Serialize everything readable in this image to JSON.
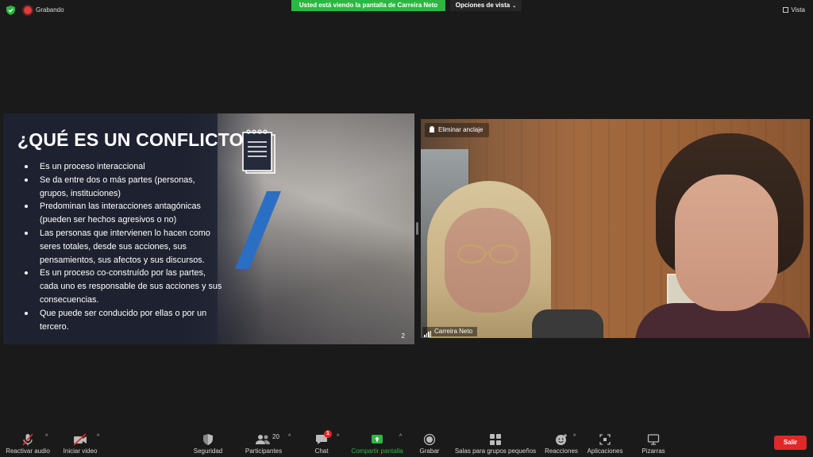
{
  "topbar": {
    "recording_label": "Grabando",
    "share_banner": "Usted está viendo la pantalla de Carreira Neto",
    "view_options_label": "Opciones de vista",
    "view_label": "Vista"
  },
  "slide": {
    "title": "¿QUÉ ES UN CONFLICTO?",
    "bullets": [
      "Es un proceso interaccional",
      "Se da entre dos o más partes (personas, grupos, instituciones)",
      "Predominan las interacciones antagónicas (pueden ser hechos agresivos o no)",
      "Las personas que intervienen lo hacen como seres totales, desde sus acciones, sus pensamientos, sus afectos y sus discursos.",
      "Es un proceso co-construído por las partes, cada uno es responsable de sus acciones y sus consecuencias.",
      "Que puede ser conducido por ellas o por un tercero."
    ],
    "page_number": "2"
  },
  "video": {
    "unpin_label": "Eliminar anclaje",
    "participant_name": "Carreira Neto"
  },
  "toolbar": {
    "unmute_label": "Reactivar audio",
    "start_video_label": "Iniciar video",
    "security_label": "Seguridad",
    "participants_label": "Participantes",
    "participants_count": "20",
    "chat_label": "Chat",
    "chat_badge": "1",
    "share_label": "Compartir pantalla",
    "record_label": "Grabar",
    "breakout_label": "Salas para grupos pequeños",
    "reactions_label": "Reacciones",
    "apps_label": "Aplicaciones",
    "whiteboards_label": "Pizarras",
    "leave_label": "Salir"
  },
  "colors": {
    "share_banner_bg": "#2db742",
    "leave_bg": "#e02828",
    "share_label_color": "#2db742",
    "slide_accent": "#2b6fc4"
  }
}
